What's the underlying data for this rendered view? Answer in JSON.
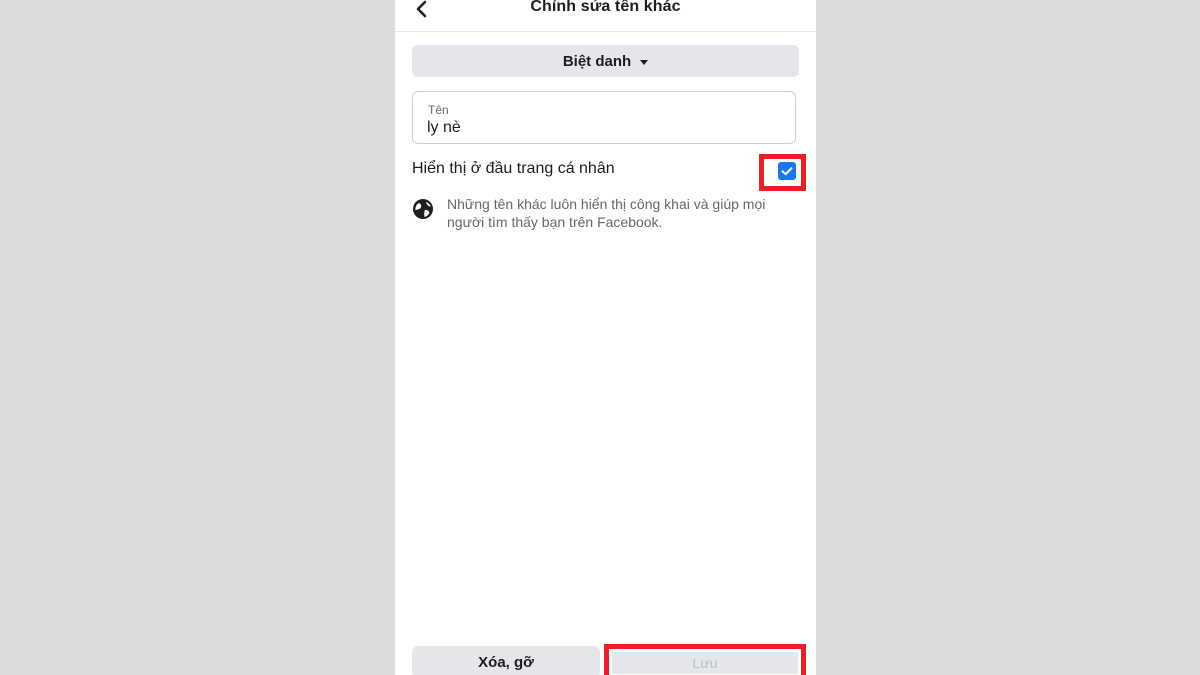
{
  "header": {
    "title": "Chỉnh sửa tên khác",
    "back_icon": "chevron-left-icon"
  },
  "type_select": {
    "label": "Biệt danh",
    "icon": "caret-down-icon"
  },
  "name_field": {
    "label": "Tên",
    "value": "ly nè"
  },
  "show_on_profile": {
    "label": "Hiển thị ở đầu trang cá nhân",
    "checked": true,
    "icon": "checkmark-icon"
  },
  "info": {
    "icon": "globe-icon",
    "text": "Những tên khác luôn hiển thị công khai và giúp mọi người tìm thấy bạn trên Facebook."
  },
  "footer": {
    "delete_label": "Xóa, gỡ",
    "save_label": "Lưu"
  },
  "colors": {
    "accent": "#1877f2",
    "highlight": "#ee1c25",
    "button_bg": "#e4e6eb",
    "disabled_text": "#bcc0c4"
  }
}
